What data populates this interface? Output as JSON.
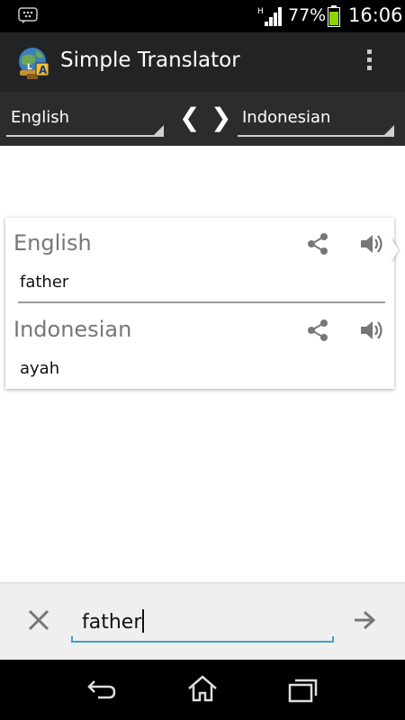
{
  "status_bar": {
    "battery_percent": "77%",
    "time": "16:06",
    "icons": [
      "blackberry-messenger-icon",
      "signal-icon",
      "battery-icon"
    ]
  },
  "action_bar": {
    "title": "Simple Translator",
    "icons": [
      "app-globe-icon",
      "overflow-menu-icon"
    ]
  },
  "language_bar": {
    "source_language": "English",
    "target_language": "Indonesian",
    "prev_glyph": "❮",
    "next_glyph": "❯"
  },
  "translation_card": {
    "source": {
      "language": "English",
      "text": "father"
    },
    "target": {
      "language": "Indonesian",
      "text": "ayah"
    },
    "icons": [
      "share-icon",
      "speaker-icon"
    ]
  },
  "input_bar": {
    "value": "father",
    "icons": [
      "clear-icon",
      "send-arrow-icon"
    ]
  },
  "nav_bar": {
    "icons": [
      "back-icon",
      "home-icon",
      "recent-apps-icon"
    ]
  },
  "colors": {
    "action_bar": "#222324",
    "language_bar": "#2b2c2d",
    "input_accent": "#3aa0cc",
    "label_gray": "#777777"
  }
}
